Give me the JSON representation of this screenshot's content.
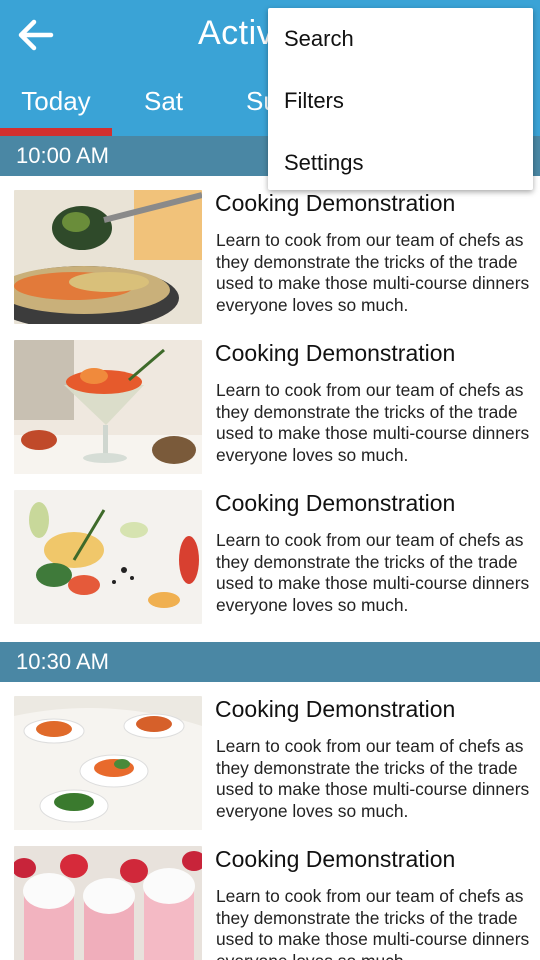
{
  "appbar": {
    "title": "Activities",
    "back_icon": "arrow-left-icon",
    "bg_color": "#3aa3d6"
  },
  "tabs": [
    {
      "label": "Today",
      "active": true
    },
    {
      "label": "Sat",
      "active": false
    },
    {
      "label": "Sun",
      "active": false
    }
  ],
  "accent_color": "#d32f2f",
  "header_color": "#4a87a4",
  "sections": [
    {
      "time": "10:00 AM",
      "items": [
        {
          "title": "Cooking Demonstration",
          "description": "Learn to cook from our team of chefs as they demonstrate the tricks of the trade used to make those multi-course dinners everyone loves so much.",
          "image": "pan-with-spoon-photo"
        },
        {
          "title": "Cooking Demonstration",
          "description": "Learn to cook from our team of chefs as they demonstrate the tricks of the trade used to make those multi-course dinners everyone loves so much.",
          "image": "cocktail-glass-appetizer-photo"
        },
        {
          "title": "Cooking Demonstration",
          "description": "Learn to cook from our team of chefs as they demonstrate the tricks of the trade used to make those multi-course dinners everyone loves so much.",
          "image": "plated-salad-photo"
        }
      ]
    },
    {
      "time": "10:30 AM",
      "items": [
        {
          "title": "Cooking Demonstration",
          "description": "Learn to cook from our team of chefs as they demonstrate the tricks of the trade used to make those multi-course dinners everyone loves so much.",
          "image": "spoon-appetizers-photo"
        },
        {
          "title": "Cooking Demonstration",
          "description": "Learn to cook from our team of chefs as they demonstrate the tricks of the trade used to make those multi-course dinners everyone loves so much.",
          "image": "strawberry-cream-dessert-photo"
        }
      ]
    }
  ],
  "overflow_menu": {
    "items": [
      {
        "label": "Search"
      },
      {
        "label": "Filters"
      },
      {
        "label": "Settings"
      }
    ]
  }
}
